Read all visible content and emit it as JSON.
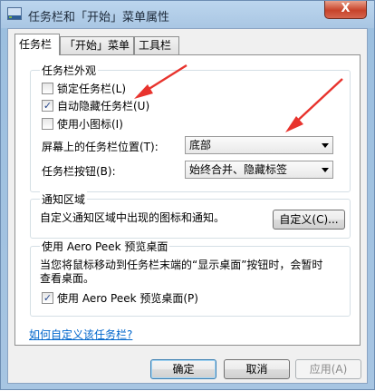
{
  "window": {
    "title": "任务栏和「开始」菜单属性",
    "close_symbol": "X"
  },
  "tabs": [
    {
      "label": "任务栏",
      "active": true
    },
    {
      "label": "「开始」菜单",
      "active": false
    },
    {
      "label": "工具栏",
      "active": false
    }
  ],
  "appearance": {
    "legend": "任务栏外观",
    "lock_taskbar": {
      "label": "锁定任务栏(L)",
      "checked": false
    },
    "auto_hide": {
      "label": "自动隐藏任务栏(U)",
      "checked": true
    },
    "small_icons": {
      "label": "使用小图标(I)",
      "checked": false
    },
    "location_label": "屏幕上的任务栏位置(T):",
    "location_value": "底部",
    "buttons_label": "任务栏按钮(B):",
    "buttons_value": "始终合并、隐藏标签"
  },
  "notification": {
    "legend": "通知区域",
    "description": "自定义通知区域中出现的图标和通知。",
    "customize_button": "自定义(C)..."
  },
  "aero_peek": {
    "legend": "使用 Aero Peek 预览桌面",
    "description_line1": "当您将鼠标移动到任务栏末端的“显示桌面”按钮时，会暂时",
    "description_line2": "查看桌面。",
    "use_peek": {
      "label": "使用 Aero Peek 预览桌面(P)",
      "checked": true
    }
  },
  "help_link": "如何自定义该任务栏?",
  "buttons": {
    "ok": "确定",
    "cancel": "取消",
    "apply": "应用(A)"
  },
  "colors": {
    "annotation_arrow": "#e8332d",
    "link": "#0066cc"
  }
}
